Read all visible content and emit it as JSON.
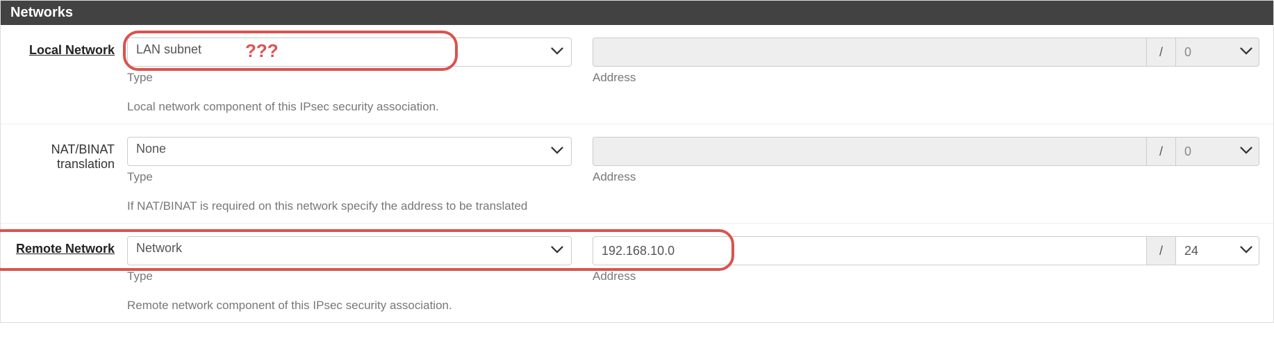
{
  "panel": {
    "title": "Networks"
  },
  "local": {
    "label": "Local Network",
    "type_value": "LAN subnet",
    "type_sub": "Type",
    "addr_value": "",
    "addr_sub": "Address",
    "slash": "/",
    "mask_value": "0",
    "help": "Local network component of this IPsec security association.",
    "annot_q": "???"
  },
  "nat": {
    "label": "NAT/BINAT translation",
    "type_value": "None",
    "type_sub": "Type",
    "addr_value": "",
    "addr_sub": "Address",
    "slash": "/",
    "mask_value": "0",
    "help": "If NAT/BINAT is required on this network specify the address to be translated"
  },
  "remote": {
    "label": "Remote Network",
    "type_value": "Network",
    "type_sub": "Type",
    "addr_value": "192.168.10.0",
    "addr_sub": "Address",
    "slash": "/",
    "mask_value": "24",
    "help": "Remote network component of this IPsec security association."
  }
}
